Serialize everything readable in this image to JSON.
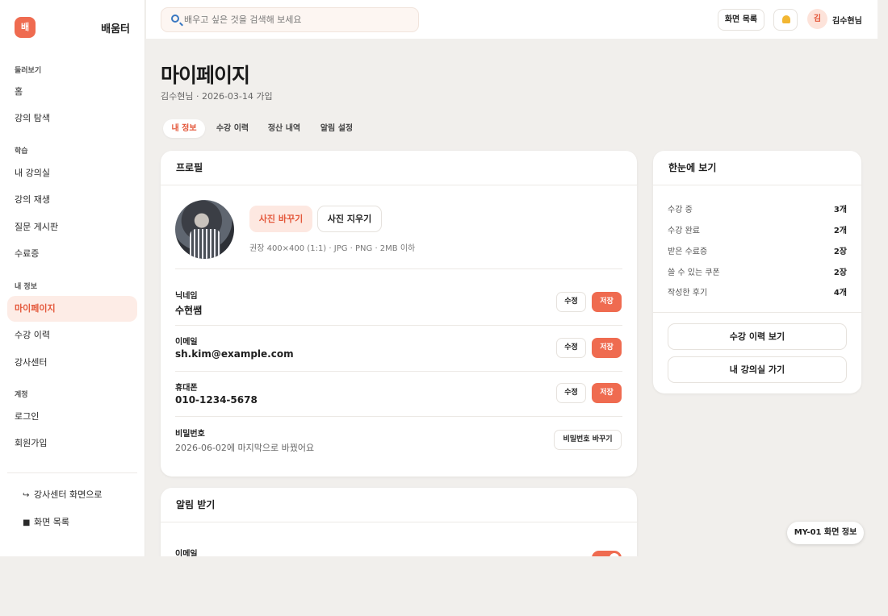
{
  "brand": {
    "logo_text": "배",
    "name": "배움터"
  },
  "sidebar": {
    "sections": [
      {
        "title": "둘러보기",
        "items": [
          "홈",
          "강의 탐색"
        ]
      },
      {
        "title": "학습",
        "items": [
          "내 강의실",
          "강의 재생",
          "질문 게시판",
          "수료증"
        ]
      },
      {
        "title": "내 정보",
        "items": [
          "마이페이지",
          "수강 이력",
          "강사센터"
        ]
      },
      {
        "title": "계정",
        "items": [
          "로그인",
          "회원가입"
        ]
      }
    ],
    "active_item": "마이페이지",
    "footer": {
      "instructor_link": "강사센터 화면으로",
      "screen_list": "화면 목록"
    }
  },
  "header": {
    "search_placeholder": "배우고 싶은 것을 검색해 보세요",
    "screen_list_label": "화면 목록",
    "avatar_initial": "김",
    "user_name": "김수현님"
  },
  "page": {
    "title": "마이페이지",
    "subtitle": "김수현님 · 2026-03-14 가입",
    "tabs": [
      "내 정보",
      "수강 이력",
      "정산 내역",
      "알림 설정"
    ],
    "active_tab": "내 정보"
  },
  "profile": {
    "title": "프로필",
    "change_photo": "사진 바꾸기",
    "remove_photo": "사진 지우기",
    "photo_hint": "권장 400×400 (1:1) · JPG · PNG · 2MB 이하",
    "edit_label": "수정",
    "save_label": "저장",
    "fields": [
      {
        "label": "닉네임",
        "value": "수현쌤"
      },
      {
        "label": "이메일",
        "value": "sh.kim@example.com"
      },
      {
        "label": "휴대폰",
        "value": "010-1234-5678"
      }
    ],
    "password": {
      "label": "비밀번호",
      "value": "2026-06-02에 마지막으로 바꿨어요",
      "button": "비밀번호 바꾸기"
    }
  },
  "notifications": {
    "title": "알림 받기",
    "first_item": "이메일",
    "first_item_on": true
  },
  "summary": {
    "title": "한눈에 보기",
    "stats": [
      {
        "label": "수강 중",
        "value": "3개"
      },
      {
        "label": "수강 완료",
        "value": "2개"
      },
      {
        "label": "받은 수료증",
        "value": "2장"
      },
      {
        "label": "쓸 수 있는 쿠폰",
        "value": "2장"
      },
      {
        "label": "작성한 후기",
        "value": "4개"
      }
    ],
    "history_button": "수강 이력 보기",
    "classroom_button": "내 강의실 가기"
  },
  "screen_chip": "MY-01 화면 정보",
  "colors": {
    "accent": "#ef6b50",
    "accent_soft": "#fde8e1",
    "background": "#f1efec"
  }
}
